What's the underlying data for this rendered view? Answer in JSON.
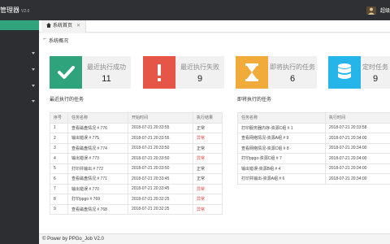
{
  "app": {
    "brand_title": "管理器",
    "version": "V2.0",
    "user_name": "超级",
    "user_icon": "user-icon"
  },
  "sidebar": {
    "items": [
      "",
      "",
      "",
      "",
      ""
    ]
  },
  "tabs": [
    {
      "label": "系统首页",
      "close": "✕",
      "icon": "home-icon"
    }
  ],
  "page": {
    "back_symbol": "←",
    "title": "系统概况"
  },
  "stats": [
    {
      "label": "最近执行成功",
      "value": "11",
      "color": "#2fa37b",
      "icon": "check-icon"
    },
    {
      "label": "最近执行失败",
      "value": "9",
      "color": "#e55548",
      "icon": "exclamation-icon"
    },
    {
      "label": "即将执行的任务",
      "value": "6",
      "color": "#f1ab3b",
      "icon": "hourglass-icon"
    },
    {
      "label": "定时任务",
      "value": "9",
      "color": "#26b5e8",
      "icon": "database-icon"
    }
  ],
  "recent": {
    "title": "最近执行的任务",
    "headers": [
      "序号",
      "任务名称",
      "开始时间",
      "执行结果"
    ],
    "rows": [
      [
        "1",
        "查看磁盘情况 # 776",
        "2018-07-21 20:33:55",
        "正常"
      ],
      [
        "2",
        "输出错误 # 775",
        "2018-07-21 20:33:55",
        "异常"
      ],
      [
        "3",
        "查看磁盘情况 # 774",
        "2018-07-21 20:33:50",
        "正常"
      ],
      [
        "4",
        "输出错误 # 773",
        "2018-07-21 20:33:50",
        "异常"
      ],
      [
        "5",
        "打印并输出 # 772",
        "2018-07-21 20:33:50",
        "正常"
      ],
      [
        "6",
        "查看磁盘情况 # 771",
        "2018-07-21 20:33:45",
        "正常"
      ],
      [
        "7",
        "输出错误 # 770",
        "2018-07-21 20:33:45",
        "异常"
      ],
      [
        "8",
        "打印ppgo # 769",
        "2018-07-21 20:32:25",
        "异常"
      ],
      [
        "9",
        "查看磁盘情况 # 768",
        "2018-07-21 20:32:25",
        "异常"
      ]
    ]
  },
  "upcoming": {
    "title": "即将执行的任务",
    "headers": [
      "任务名称",
      "执行时间"
    ],
    "rows": [
      [
        "打印服务器内存-资源C组 # 1",
        "2018-07-21 20:33:58"
      ],
      [
        "查看网络情况-资源A组 # 9",
        "2018-07-21 20:34:00"
      ],
      [
        "查看网络情况-资源C组 # 8",
        "2018-07-21 20:34:00"
      ],
      [
        "打印ppgo-资源C组 # 7",
        "2018-07-21 20:34:00"
      ],
      [
        "输出错误-资源B组 # 4",
        "2018-07-21 20:34:00"
      ],
      [
        "打印并输出-资源A组 # 6",
        "2018-07-21 20:34:00"
      ]
    ]
  },
  "footer": {
    "text": "© Power by PPGo_Job V2.0"
  }
}
